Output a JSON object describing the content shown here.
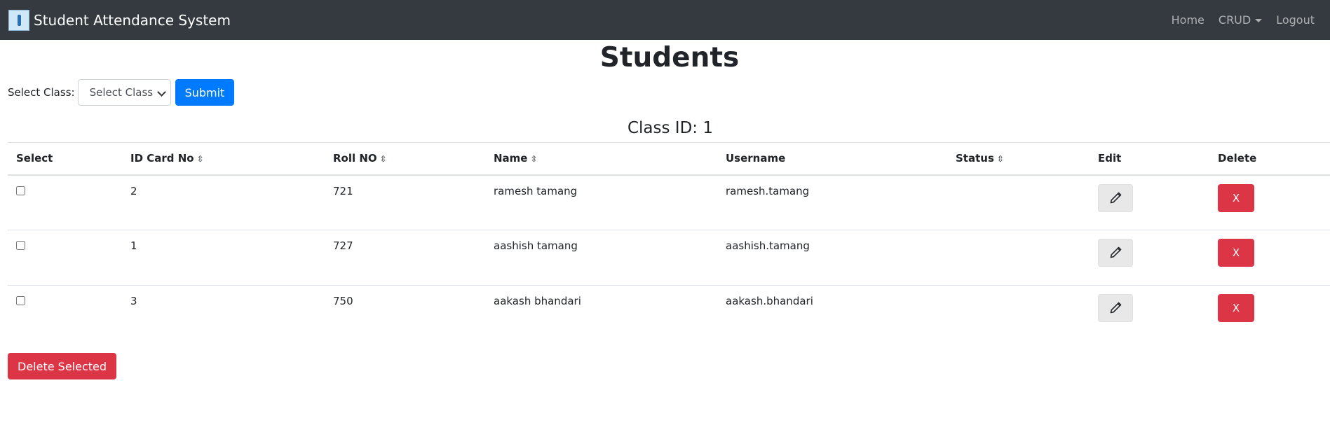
{
  "navbar": {
    "brand": "Student Attendance System",
    "links": {
      "home": "Home",
      "crud": "CRUD",
      "logout": "Logout"
    }
  },
  "page": {
    "title": "Students",
    "filter_label": "Select Class:",
    "select_value": "Select Class",
    "submit_label": "Submit",
    "class_id_label": "Class ID: 1"
  },
  "table": {
    "headers": {
      "select": "Select",
      "id_card": "ID Card No",
      "roll": "Roll NO",
      "name": "Name",
      "username": "Username",
      "status": "Status",
      "edit": "Edit",
      "delete": "Delete"
    },
    "sort_glyph": "⇳",
    "rows": [
      {
        "id_card": "2",
        "roll": "721",
        "name": "ramesh tamang",
        "username": "ramesh.tamang",
        "status": "",
        "delete_label": "X"
      },
      {
        "id_card": "1",
        "roll": "727",
        "name": "aashish tamang",
        "username": "aashish.tamang",
        "status": "",
        "delete_label": "X"
      },
      {
        "id_card": "3",
        "roll": "750",
        "name": "aakash bhandari",
        "username": "aakash.bhandari",
        "status": "",
        "delete_label": "X"
      }
    ]
  },
  "footer": {
    "delete_selected_label": "Delete Selected"
  },
  "icons": {
    "brand": "app-logo-icon",
    "edit": "pencil-icon",
    "dropdown": "caret-down-icon"
  },
  "colors": {
    "navbar_bg": "#343a40",
    "primary": "#007bff",
    "danger": "#dc3545",
    "edit_bg": "#e8e8e8"
  }
}
